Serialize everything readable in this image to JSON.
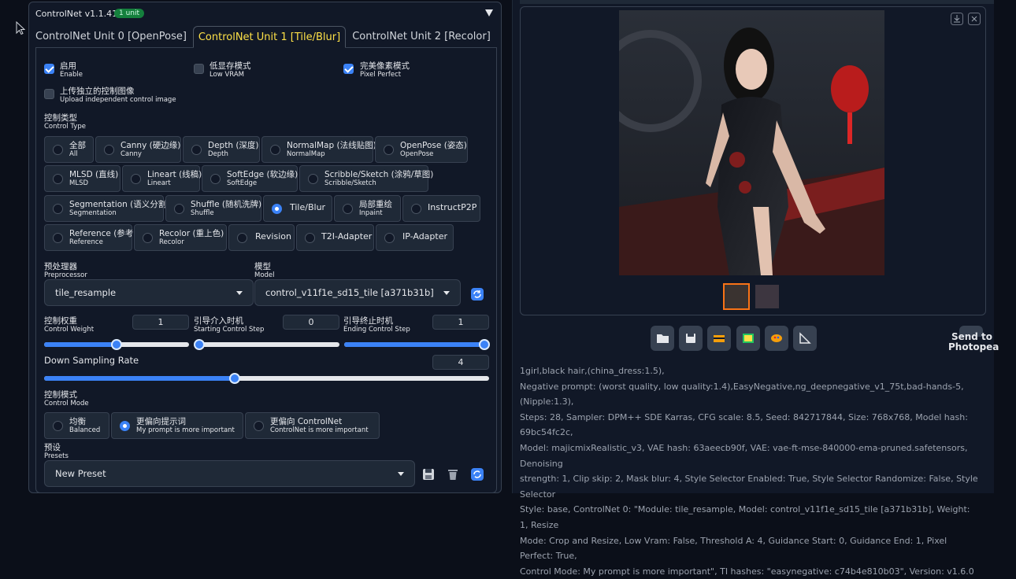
{
  "controlnet": {
    "title": "ControlNet v1.1.410",
    "badge": "1 unit",
    "tabs": [
      {
        "label": "ControlNet Unit 0 [OpenPose]",
        "active": false
      },
      {
        "label": "ControlNet Unit 1 [Tile/Blur]",
        "active": true
      },
      {
        "label": "ControlNet Unit 2 [Recolor]",
        "active": false
      }
    ],
    "checkboxes": {
      "enable": {
        "zh": "启用",
        "en": "Enable",
        "checked": true
      },
      "low_vram": {
        "zh": "低显存模式",
        "en": "Low VRAM",
        "checked": false
      },
      "pixel_perfect": {
        "zh": "完美像素模式",
        "en": "Pixel Perfect",
        "checked": true
      },
      "upload_independent": {
        "zh": "上传独立的控制图像",
        "en": "Upload independent control image",
        "checked": false
      }
    },
    "control_type": {
      "label_zh": "控制类型",
      "label_en": "Control Type",
      "rows": [
        [
          {
            "zh": "全部",
            "en": "All"
          },
          {
            "zh": "Canny (硬边缘)",
            "en": "Canny"
          },
          {
            "zh": "Depth (深度)",
            "en": "Depth"
          },
          {
            "zh": "NormalMap (法线贴图)",
            "en": "NormalMap"
          },
          {
            "zh": "OpenPose (姿态)",
            "en": "OpenPose"
          }
        ],
        [
          {
            "zh": "MLSD (直线)",
            "en": "MLSD"
          },
          {
            "zh": "Lineart (线稿)",
            "en": "Lineart"
          },
          {
            "zh": "SoftEdge (软边缘)",
            "en": "SoftEdge"
          },
          {
            "zh": "Scribble/Sketch (涂鸦/草图)",
            "en": "Scribble/Sketch"
          }
        ],
        [
          {
            "zh": "Segmentation (语义分割)",
            "en": "Segmentation"
          },
          {
            "zh": "Shuffle (随机洗牌)",
            "en": "Shuffle"
          },
          {
            "zh": "Tile/Blur",
            "en": ""
          },
          {
            "zh": "局部重绘",
            "en": "Inpaint"
          },
          {
            "zh": "InstructP2P",
            "en": ""
          }
        ],
        [
          {
            "zh": "Reference (参考)",
            "en": "Reference"
          },
          {
            "zh": "Recolor (重上色)",
            "en": "Recolor"
          },
          {
            "zh": "Revision",
            "en": ""
          },
          {
            "zh": "T2I-Adapter",
            "en": ""
          },
          {
            "zh": "IP-Adapter",
            "en": ""
          }
        ]
      ],
      "selected": "Tile/Blur"
    },
    "preprocessor": {
      "label_zh": "预处理器",
      "label_en": "Preprocessor",
      "value": "tile_resample"
    },
    "model": {
      "label_zh": "模型",
      "label_en": "Model",
      "value": "control_v11f1e_sd15_tile [a371b31b]"
    },
    "control_weight": {
      "label_zh": "控制权重",
      "label_en": "Control Weight",
      "value": "1",
      "min": 0,
      "max": 2,
      "level": 1
    },
    "starting_step": {
      "label_zh": "引导介入时机",
      "label_en": "Starting Control Step",
      "value": "0",
      "min": 0,
      "max": 1,
      "level": 0
    },
    "ending_step": {
      "label_zh": "引导终止时机",
      "label_en": "Ending Control Step",
      "value": "1",
      "min": 0,
      "max": 1,
      "level": 1
    },
    "down_sampling": {
      "label": "Down Sampling Rate",
      "value": "4",
      "min": 1,
      "max": 8,
      "level": 4
    },
    "control_mode": {
      "label_zh": "控制模式",
      "label_en": "Control Mode",
      "options": [
        {
          "zh": "均衡",
          "en": "Balanced"
        },
        {
          "zh": "更偏向提示词",
          "en": "My prompt is more important"
        },
        {
          "zh": "更偏向 ControlNet",
          "en": "ControlNet is more important"
        }
      ],
      "selected_index": 1
    },
    "presets": {
      "label_zh": "预设",
      "label_en": "Presets",
      "value": "New Preset"
    }
  },
  "output": {
    "send_to_photopea": "Send to Photopea",
    "info_lines": [
      "1girl,black hair,(china_dress:1.5),",
      "Negative prompt: (worst quality, low quality:1.4),EasyNegative,ng_deepnegative_v1_75t,bad-hands-5,(Nipple:1.3),",
      "Steps: 28, Sampler: DPM++ SDE Karras, CFG scale: 8.5, Seed: 842717844, Size: 768x768, Model hash: 69bc54fc2c,",
      "Model: majicmixRealistic_v3, VAE hash: 63aeecb90f, VAE: vae-ft-mse-840000-ema-pruned.safetensors, Denoising",
      "strength: 1, Clip skip: 2, Mask blur: 4, Style Selector Enabled: True, Style Selector Randomize: False, Style Selector",
      "Style: base, ControlNet 0: \"Module: tile_resample, Model: control_v11f1e_sd15_tile [a371b31b], Weight: 1, Resize",
      "Mode: Crop and Resize, Low Vram: False, Threshold A: 4, Guidance Start: 0, Guidance End: 1, Pixel Perfect: True,",
      "Control Mode: My prompt is more important\", TI hashes: \"easynegative: c74b4e810b03\", Version: v1.6.0"
    ]
  }
}
